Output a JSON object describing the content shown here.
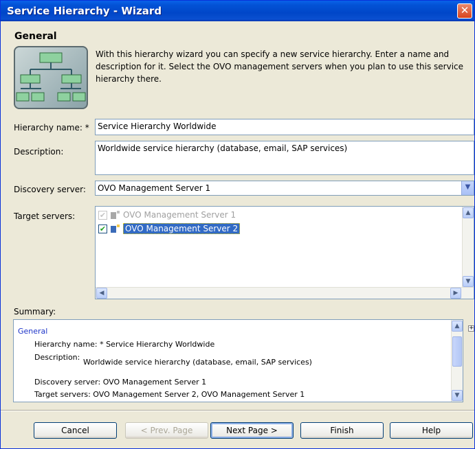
{
  "window": {
    "title": "Service Hierarchy - Wizard",
    "close_symbol": "✕"
  },
  "general": {
    "heading": "General",
    "intro": "With this hierarchy wizard you can specify a new service hierarchy. Enter a name and description for it. Select the OVO management servers when you plan to use this service hierarchy there."
  },
  "form": {
    "hierarchy_name_label": "Hierarchy name: *",
    "hierarchy_name_value": "Service Hierarchy Worldwide",
    "description_label": "Description:",
    "description_value": "Worldwide service hierarchy (database, email, SAP services)",
    "discovery_server_label": "Discovery server:",
    "discovery_server_value": "OVO Management Server 1",
    "target_servers_label": "Target servers:",
    "target_servers": [
      {
        "label": "OVO Management Server 1",
        "checked": true,
        "disabled": true
      },
      {
        "label": "OVO Management Server 2",
        "checked": true,
        "disabled": false
      }
    ]
  },
  "summary": {
    "label": "Summary:",
    "section_title": "General",
    "hierarchy_name_label": "Hierarchy name: *",
    "hierarchy_name_value": "Service Hierarchy Worldwide",
    "description_label": "Description:",
    "description_value": "Worldwide service hierarchy (database, email, SAP services)",
    "discovery_server_label": "Discovery server:",
    "discovery_server_value": "OVO Management Server 1",
    "target_servers_label": "Target servers:",
    "target_servers_value": "OVO Management Server 2,  OVO Management Server 1"
  },
  "buttons": {
    "cancel": "Cancel",
    "prev": "< Prev. Page",
    "next": "Next Page >",
    "finish": "Finish",
    "help": "Help"
  }
}
